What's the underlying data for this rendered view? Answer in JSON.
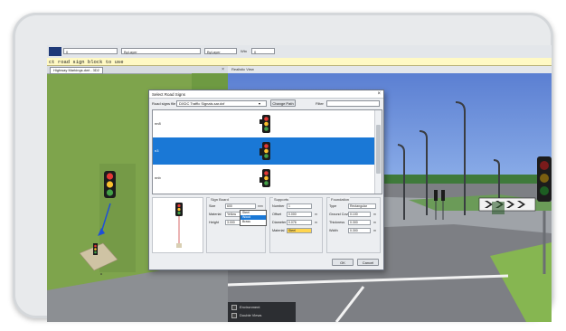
{
  "toolbar": {
    "field1": "0",
    "field2": "ByLayer",
    "field3": "ByLayer",
    "field4_label": "Wtn",
    "field4": "0"
  },
  "command_line": "ct road sign block to use",
  "drawing_tab": {
    "label": "Highway Markings.dwt - 3D2",
    "close": "×"
  },
  "view_tab": "Realistic View",
  "status": {
    "option1": "Environment",
    "option2": "Double Views"
  },
  "dialog": {
    "title": "Select Road Signs",
    "close": "×",
    "road_signs_file_label": "Road signs file",
    "road_signs_file": "DXDC Traffic Signals.sar.dxf",
    "change_path": "Change Path",
    "filter_label": "Filter",
    "filter_value": "",
    "signs": [
      {
        "name": "nn8",
        "selected": false
      },
      {
        "name": "n3",
        "selected": true
      },
      {
        "name": "nnb",
        "selected": false
      }
    ],
    "sign_board": {
      "title": "Sign Board",
      "size_label": "Size",
      "size": "600",
      "size_unit": "mm",
      "material_label": "Material",
      "material": "Yellow",
      "height_label": "Height",
      "height": "3.000",
      "height_unit": "m"
    },
    "supports": {
      "title": "Supports",
      "number_label": "Number",
      "number": "1",
      "offset_label": "Offset",
      "offset": "0.000",
      "offset_unit": "m",
      "diameter_label": "Diameter",
      "diameter": "0.076",
      "diameter_unit": "m",
      "material_label": "Material",
      "material": "Steel",
      "material_options": [
        "Steel",
        "Wood",
        "Brass",
        "Other"
      ]
    },
    "foundation": {
      "title": "Foundation",
      "type_label": "Type",
      "type": "Rectangular",
      "ground_cover_label": "Ground Cover",
      "ground_cover": "0.100",
      "thickness_label": "Thickness",
      "thickness": "0.300",
      "width_label": "Width",
      "width": "0.300",
      "unit": "m"
    },
    "ok": "OK",
    "cancel": "Cancel"
  }
}
